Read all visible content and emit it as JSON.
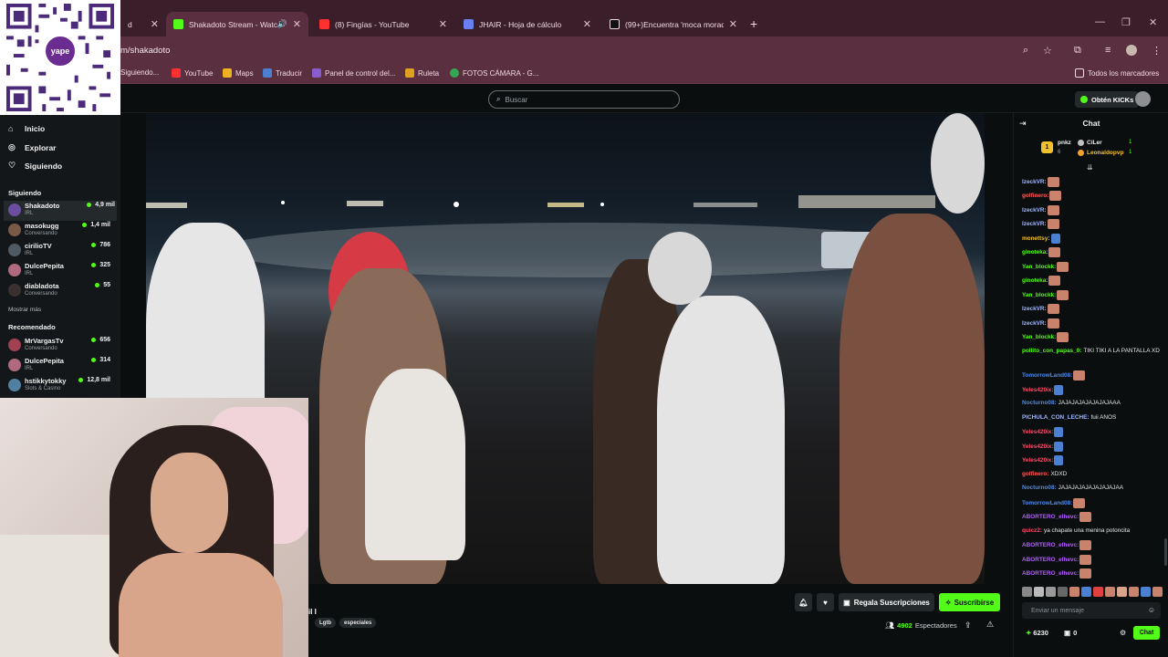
{
  "browser": {
    "tabs": [
      {
        "label": "d",
        "color": "#c0c0c0"
      },
      {
        "label": "Shakadoto Stream - Watch",
        "color": "#53fc18",
        "active": true
      },
      {
        "label": "(8) Fingías - YouTube",
        "color": "#ff3030"
      },
      {
        "label": "JHAIR - Hoja de cálculo",
        "color": "#6a7ff0"
      },
      {
        "label": "(99+)Encuentra 'moca moradito'",
        "color": "#111111"
      }
    ],
    "url": "m/shakadoto",
    "bookmarks": [
      {
        "label": "Siguiendo...",
        "color": "#888888"
      },
      {
        "label": "YouTube",
        "color": "#ff3030"
      },
      {
        "label": "Maps",
        "color": "#f0b020"
      },
      {
        "label": "Traducir",
        "color": "#4b7fd1"
      },
      {
        "label": "Panel de control del...",
        "color": "#8a5cd0"
      },
      {
        "label": "Ruleta",
        "color": "#e0a020"
      },
      {
        "label": "FOTOS CÁMARA - G...",
        "color": "#34a853"
      }
    ],
    "all_bookmarks": "Todos los marcadores"
  },
  "header": {
    "search_placeholder": "Buscar",
    "kicks_label": "Obtén KICKs"
  },
  "qr": {
    "logo_text": "yape"
  },
  "sidebar": {
    "nav": [
      {
        "label": "Inicio",
        "icon": "home-icon"
      },
      {
        "label": "Explorar",
        "icon": "compass-icon"
      },
      {
        "label": "Siguiendo",
        "icon": "heart-icon"
      }
    ],
    "following_title": "Siguiendo",
    "following": [
      {
        "name": "Shakadoto",
        "category": "IRL",
        "viewers": "4,9 mil",
        "color": "#6b4ea0"
      },
      {
        "name": "masokugg",
        "category": "Conversando",
        "viewers": "1,4 mil",
        "color": "#7a5a48"
      },
      {
        "name": "cirilioTV",
        "category": "IRL",
        "viewers": "786",
        "color": "#505a62"
      },
      {
        "name": "DulcePepita",
        "category": "IRL",
        "viewers": "325",
        "color": "#b06a80"
      },
      {
        "name": "diabladota",
        "category": "Conversando",
        "viewers": "55",
        "color": "#3a3030"
      }
    ],
    "show_more": "Mostrar más",
    "recommended_title": "Recomendado",
    "recommended": [
      {
        "name": "MrVargasTv",
        "category": "Conversando",
        "viewers": "656",
        "color": "#a04050"
      },
      {
        "name": "DulcePepita",
        "category": "IRL",
        "viewers": "314",
        "color": "#b06a80"
      },
      {
        "name": "hstikkytokky",
        "category": "Slots & Casino",
        "viewers": "12,8 mil",
        "color": "#5080a0"
      }
    ]
  },
  "stream": {
    "title_fragment": "il I",
    "tags": [
      "Lgtb",
      "especiales"
    ],
    "gift_subs_label": "Regala Suscripciones",
    "subscribe_label": "Suscribirse",
    "viewers_count": "4902",
    "viewers_label": "Espectadores"
  },
  "chat": {
    "title": "Chat",
    "pinned": {
      "rank": "1",
      "name": "pnkz",
      "count": "6",
      "users": [
        {
          "name": "CiLer",
          "color": "#f0f0f0",
          "dot": "#c0c0c0",
          "rank": "1"
        },
        {
          "name": "Leonaldopvp",
          "color": "#f2c12e",
          "dot": "#f2a02e",
          "rank": "1"
        }
      ]
    },
    "messages": [
      {
        "user": "IzeckVR:",
        "color": "#9fb6ff",
        "text": "",
        "emote": "face"
      },
      {
        "user": "golfinero:",
        "color": "#ff5a5a",
        "text": "",
        "emote": "face"
      },
      {
        "user": "IzeckVR:",
        "color": "#9fb6ff",
        "text": "",
        "emote": "face"
      },
      {
        "user": "IzeckVR:",
        "color": "#9fb6ff",
        "text": "",
        "emote": "face"
      },
      {
        "user": "monettsy:",
        "color": "#f2c12e",
        "text": "",
        "emote": "blue"
      },
      {
        "user": "ginoteka:",
        "color": "#53fc18",
        "text": "",
        "emote": "face"
      },
      {
        "user": "Yan_blockk:",
        "color": "#53fc18",
        "text": "",
        "emote": "face"
      },
      {
        "user": "ginoteka:",
        "color": "#53fc18",
        "text": "",
        "emote": "face"
      },
      {
        "user": "Yan_blockk:",
        "color": "#53fc18",
        "text": "",
        "emote": "face"
      },
      {
        "user": "IzeckVR:",
        "color": "#9fb6ff",
        "text": "",
        "emote": "face"
      },
      {
        "user": "IzeckVR:",
        "color": "#9fb6ff",
        "text": "",
        "emote": "face"
      },
      {
        "user": "Yan_blockk:",
        "color": "#53fc18",
        "text": "",
        "emote": "face"
      },
      {
        "user": "pollito_con_papas_0:",
        "color": "#53fc18",
        "text": "TIKI TIKI A LA PANTALLA XD",
        "emote": ""
      },
      {
        "user": "TomorrowLand08:",
        "color": "#4b8af0",
        "text": "",
        "emote": "face"
      },
      {
        "user": "Yeles420ix:",
        "color": "#ff4a6a",
        "text": "",
        "emote": "blue"
      },
      {
        "user": "Nocturno08:",
        "color": "#4b8af0",
        "text": "JAJAJAJAJAJAJAJAAA",
        "emote": ""
      },
      {
        "user": "PICHULA_CON_LECHE:",
        "color": "#9fb6ff",
        "text": "fuii ANOS",
        "emote": ""
      },
      {
        "user": "Yeles420ix:",
        "color": "#ff4a6a",
        "text": "",
        "emote": "blue"
      },
      {
        "user": "Yeles420ix:",
        "color": "#ff4a6a",
        "text": "",
        "emote": "blue"
      },
      {
        "user": "Yeles420ix:",
        "color": "#ff4a6a",
        "text": "",
        "emote": "blue"
      },
      {
        "user": "golfinero:",
        "color": "#ff5a5a",
        "text": "XDXD",
        "emote": ""
      },
      {
        "user": "Nocturno08:",
        "color": "#4b8af0",
        "text": "JAJAJAJAJAJAJAJAJAA",
        "emote": ""
      },
      {
        "user": "TomorrowLand08:",
        "color": "#4b8af0",
        "text": "",
        "emote": "face"
      },
      {
        "user": "ABORTERO_elhevc:",
        "color": "#b45cff",
        "text": "",
        "emote": "face"
      },
      {
        "user": "quicz2:",
        "color": "#ff4a6a",
        "text": "ya chapate una menina potoncita",
        "emote": ""
      },
      {
        "user": "ABORTERO_elhevc:",
        "color": "#b45cff",
        "text": "",
        "emote": "face"
      },
      {
        "user": "ABORTERO_elhevc:",
        "color": "#b45cff",
        "text": "",
        "emote": "face"
      },
      {
        "user": "ABORTERO_elhevc:",
        "color": "#b45cff",
        "text": "",
        "emote": "face"
      }
    ],
    "input_placeholder": "Enviar un mensaje",
    "points": "6230",
    "gifts": "0",
    "chat_button": "Chat"
  }
}
